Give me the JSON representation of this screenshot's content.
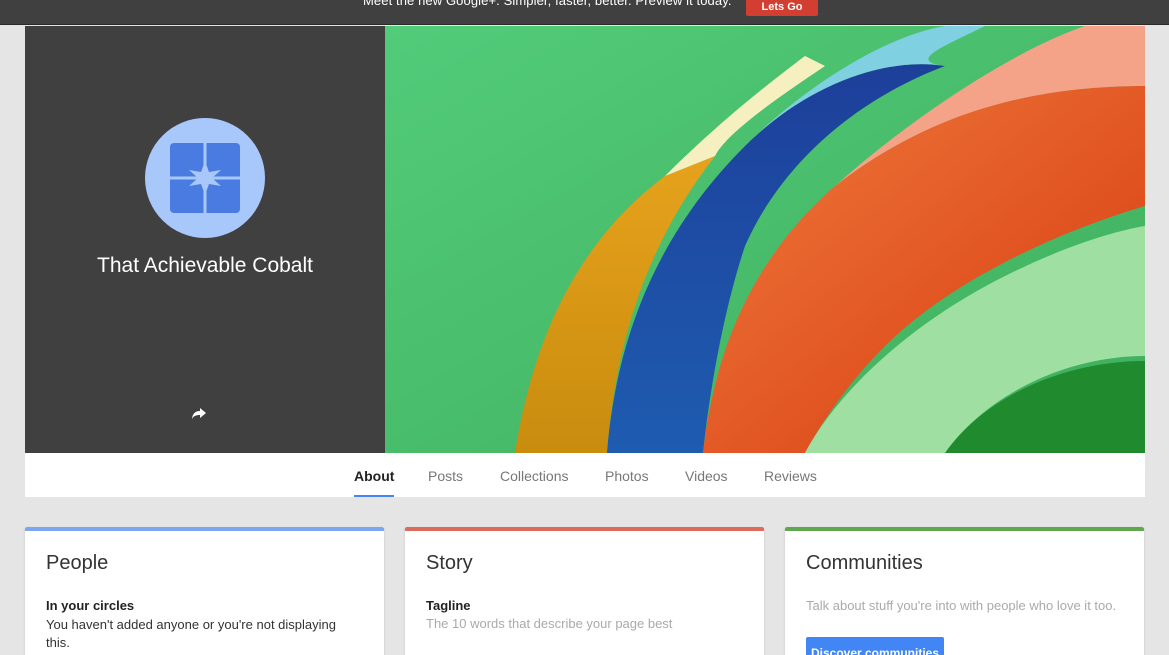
{
  "promo_bar": {
    "message": "Meet the new Google+.  Simpler, faster, better. Preview it today.",
    "button_label": "Lets Go",
    "button_color": "#d23f31"
  },
  "profile": {
    "name": "That Achievable Cobalt",
    "avatar_icon": "page-logo-icon",
    "share_icon": "share-icon",
    "avatar_bg": "#a8c7fa",
    "logo_color": "#4a7be0"
  },
  "cover": {
    "description_icon": "cover-photo-folded-paper"
  },
  "tabs": [
    {
      "label": "About",
      "active": true
    },
    {
      "label": "Posts",
      "active": false
    },
    {
      "label": "Collections",
      "active": false
    },
    {
      "label": "Photos",
      "active": false
    },
    {
      "label": "Videos",
      "active": false
    },
    {
      "label": "Reviews",
      "active": false
    }
  ],
  "cards": {
    "people": {
      "title": "People",
      "accent": "#7aa7f0",
      "subhead": "In your circles",
      "body": "You haven't added anyone or you're not displaying this."
    },
    "story": {
      "title": "Story",
      "accent": "#dc6b5c",
      "subhead": "Tagline",
      "body": "The 10 words that describe your page best"
    },
    "communities": {
      "title": "Communities",
      "accent": "#5fa84f",
      "body": "Talk about stuff you're into with people who love it too.",
      "button_label": "Discover communities"
    }
  }
}
